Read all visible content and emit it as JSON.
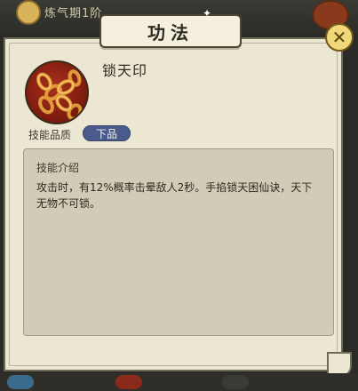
{
  "background": {
    "top_label": "炼气期1阶"
  },
  "dialog": {
    "title": "功法",
    "close_symbol": "✕"
  },
  "skill": {
    "name": "锁天印",
    "icon": "chain-icon",
    "quality_label": "技能品质",
    "quality_value": "下品"
  },
  "description": {
    "heading": "技能介绍",
    "text": "攻击时，有12%概率击晕敌人2秒。手掐锁天困仙诀，天下无物不可锁。"
  },
  "colors": {
    "panel": "#ece7d3",
    "desc_box": "#d2ccb6",
    "quality_badge": "#4a5a8a",
    "icon_bg": "#7a1a0e",
    "chain": "#e09a3a"
  }
}
